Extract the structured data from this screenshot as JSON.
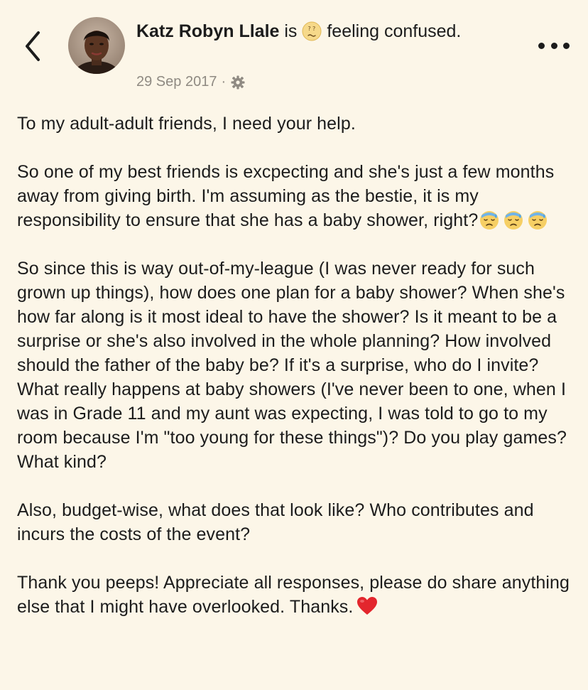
{
  "header": {
    "author": "Katz Robyn Llale",
    "activity_connector": "is",
    "activity_emoji": "confused-face-icon",
    "activity_text": "feeling confused.",
    "date": "29 Sep 2017",
    "separator": "·",
    "privacy_icon": "gear-icon",
    "back_icon": "chevron-left-icon",
    "more_icon": "ellipsis-icon"
  },
  "post": {
    "p1": "To my adult-adult friends, I need your help.",
    "p2": "So one of my best friends is excpecting and she's just a few months away from giving birth. I'm assuming as the bestie, it is my responsibility to ensure that she has a baby shower, right?",
    "p2_emojis": [
      "sweat-face-icon",
      "sweat-face-icon",
      "sweat-face-icon"
    ],
    "p3": "So since this is way out-of-my-league (I was never ready for such grown up things), how does one plan for a baby shower? When she's how far along is it most ideal to have the shower? Is it meant to be a surprise or she's also involved in the whole planning? How involved should the father of the baby be? If it's a surprise, who do I invite? What really happens at baby showers (I've never been to one, when I was in Grade 11 and my aunt was expecting, I was told to go to my room because I'm \"too young for these things\")? Do you play games? What kind?",
    "p4": "Also, budget-wise, what does that look like? Who contributes and incurs the costs of the event?",
    "p5": "Thank you peeps! Appreciate all responses, please do share anything else that I might have overlooked. Thanks.",
    "p5_emoji": "red-heart-icon"
  },
  "colors": {
    "background": "#fcf6e8",
    "text": "#1c1c1c",
    "meta": "#8f8a82",
    "heart": "#e3262d"
  }
}
